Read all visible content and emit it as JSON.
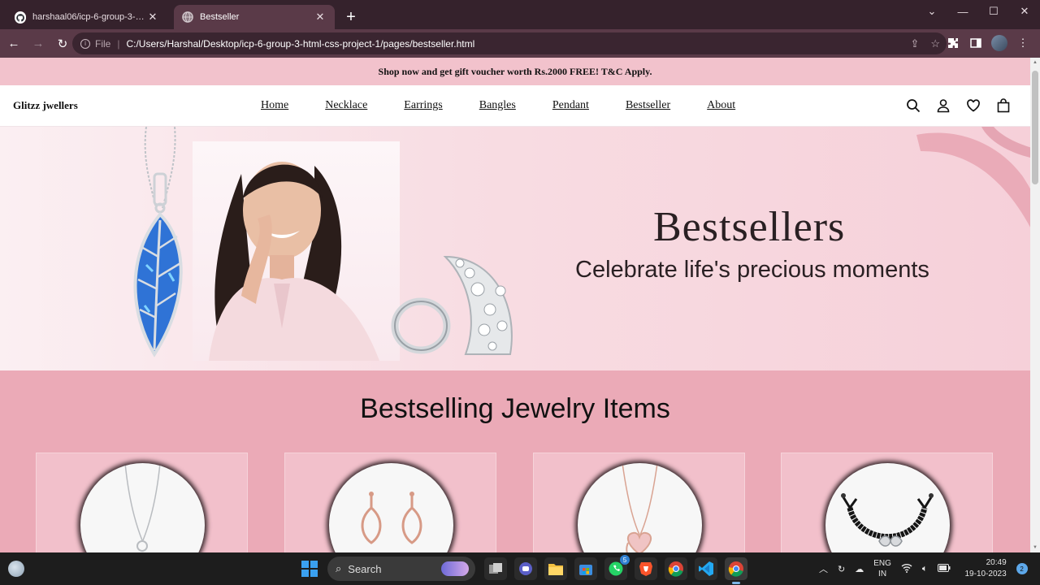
{
  "browser": {
    "tabs": [
      {
        "title": "harshaal06/icp-6-group-3-html-",
        "active": false,
        "icon": "github-icon"
      },
      {
        "title": "Bestseller",
        "active": true,
        "icon": "globe-icon"
      }
    ],
    "address": {
      "scheme": "File",
      "url": "C:/Users/Harshal/Desktop/icp-6-group-3-html-css-project-1/pages/bestseller.html"
    }
  },
  "page": {
    "announcement": "Shop now and get gift voucher worth Rs.2000 FREE! T&C Apply.",
    "brand": "Glitzz jwellers",
    "nav": [
      "Home",
      "Necklace",
      "Earrings",
      "Bangles",
      "Pendant",
      "Bestseller",
      "About"
    ],
    "hero": {
      "title": "Bestsellers",
      "subtitle": "Celebrate life's precious moments"
    },
    "section_title": "Bestselling Jewelry Items",
    "products": [
      {
        "icon": "necklace-pendant-icon"
      },
      {
        "icon": "drop-earrings-icon"
      },
      {
        "icon": "heart-pendant-icon"
      },
      {
        "icon": "black-bracelet-icon"
      }
    ]
  },
  "taskbar": {
    "search_label": "Search",
    "whatsapp_badge": "5",
    "lang_line1": "ENG",
    "lang_line2": "IN",
    "time": "20:49",
    "date": "19-10-2023",
    "notifications": "2"
  },
  "colors": {
    "chrome_tabbar": "#35222c",
    "chrome_toolbar": "#5a3a48",
    "announcement_bg": "#f2c2cc",
    "section_bg": "#ebaab7",
    "card_bg": "#f2c0cb"
  }
}
